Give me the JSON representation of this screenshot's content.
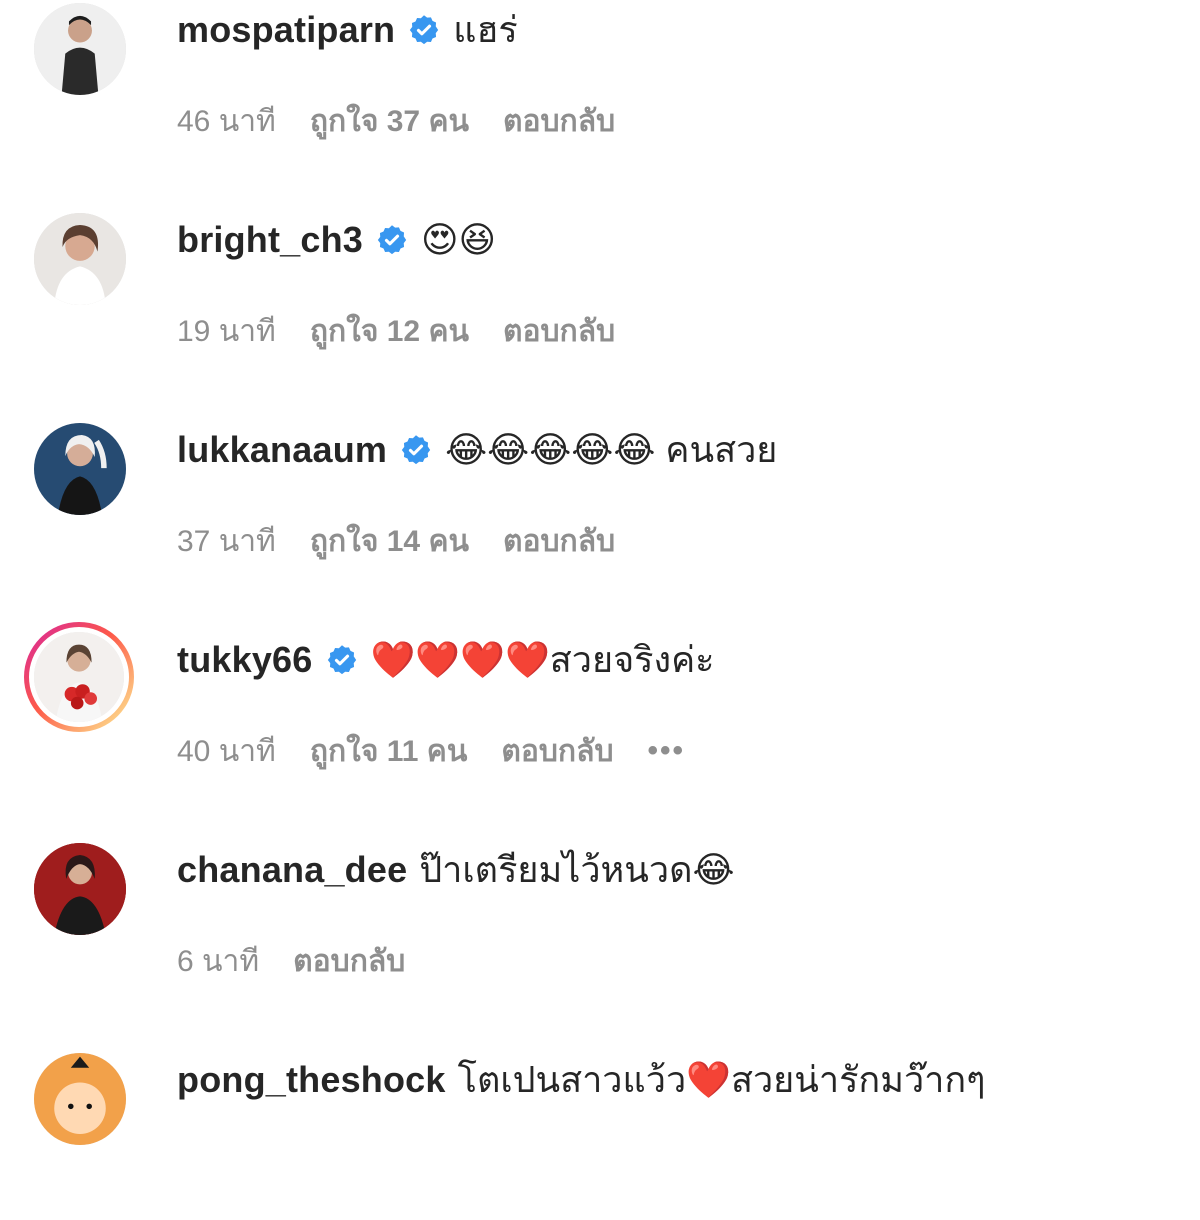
{
  "comments": [
    {
      "username": "mospatiparn",
      "verified": true,
      "text": "แฮร่",
      "time": "46 นาที",
      "likes": "ถูกใจ 37 คน",
      "reply": "ตอบกลับ"
    },
    {
      "username": "bright_ch3",
      "verified": true,
      "text": "😍😆",
      "time": "19 นาที",
      "likes": "ถูกใจ 12 คน",
      "reply": "ตอบกลับ"
    },
    {
      "username": "lukkanaaum",
      "verified": true,
      "text": "😂😂😂😂😂 คนสวย",
      "time": "37 นาที",
      "likes": "ถูกใจ 14 คน",
      "reply": "ตอบกลับ"
    },
    {
      "username": "tukky66",
      "verified": true,
      "text": "❤️❤️❤️❤️สวยจริงค่ะ",
      "time": "40 นาที",
      "likes": "ถูกใจ 11 คน",
      "reply": "ตอบกลับ",
      "more": "•••"
    },
    {
      "username": "chanana_dee",
      "verified": false,
      "text": "ป๊าเตรียมไว้หนวด😂",
      "time": "6 นาที",
      "reply": "ตอบกลับ"
    },
    {
      "username": "pong_theshock",
      "verified": false,
      "text": "โตเปนสาวแว้ว❤️สวยน่ารักมว๊ากๆ"
    }
  ],
  "colors": {
    "text": "#262626",
    "meta": "#8e8e8e",
    "verified": "#3897f0",
    "story_ring_start": "#d6249f",
    "story_ring_mid": "#fd5949",
    "story_ring_end": "#fdf497"
  },
  "icons": {
    "verified": "verified-badge-icon",
    "more": "more-options-icon"
  }
}
